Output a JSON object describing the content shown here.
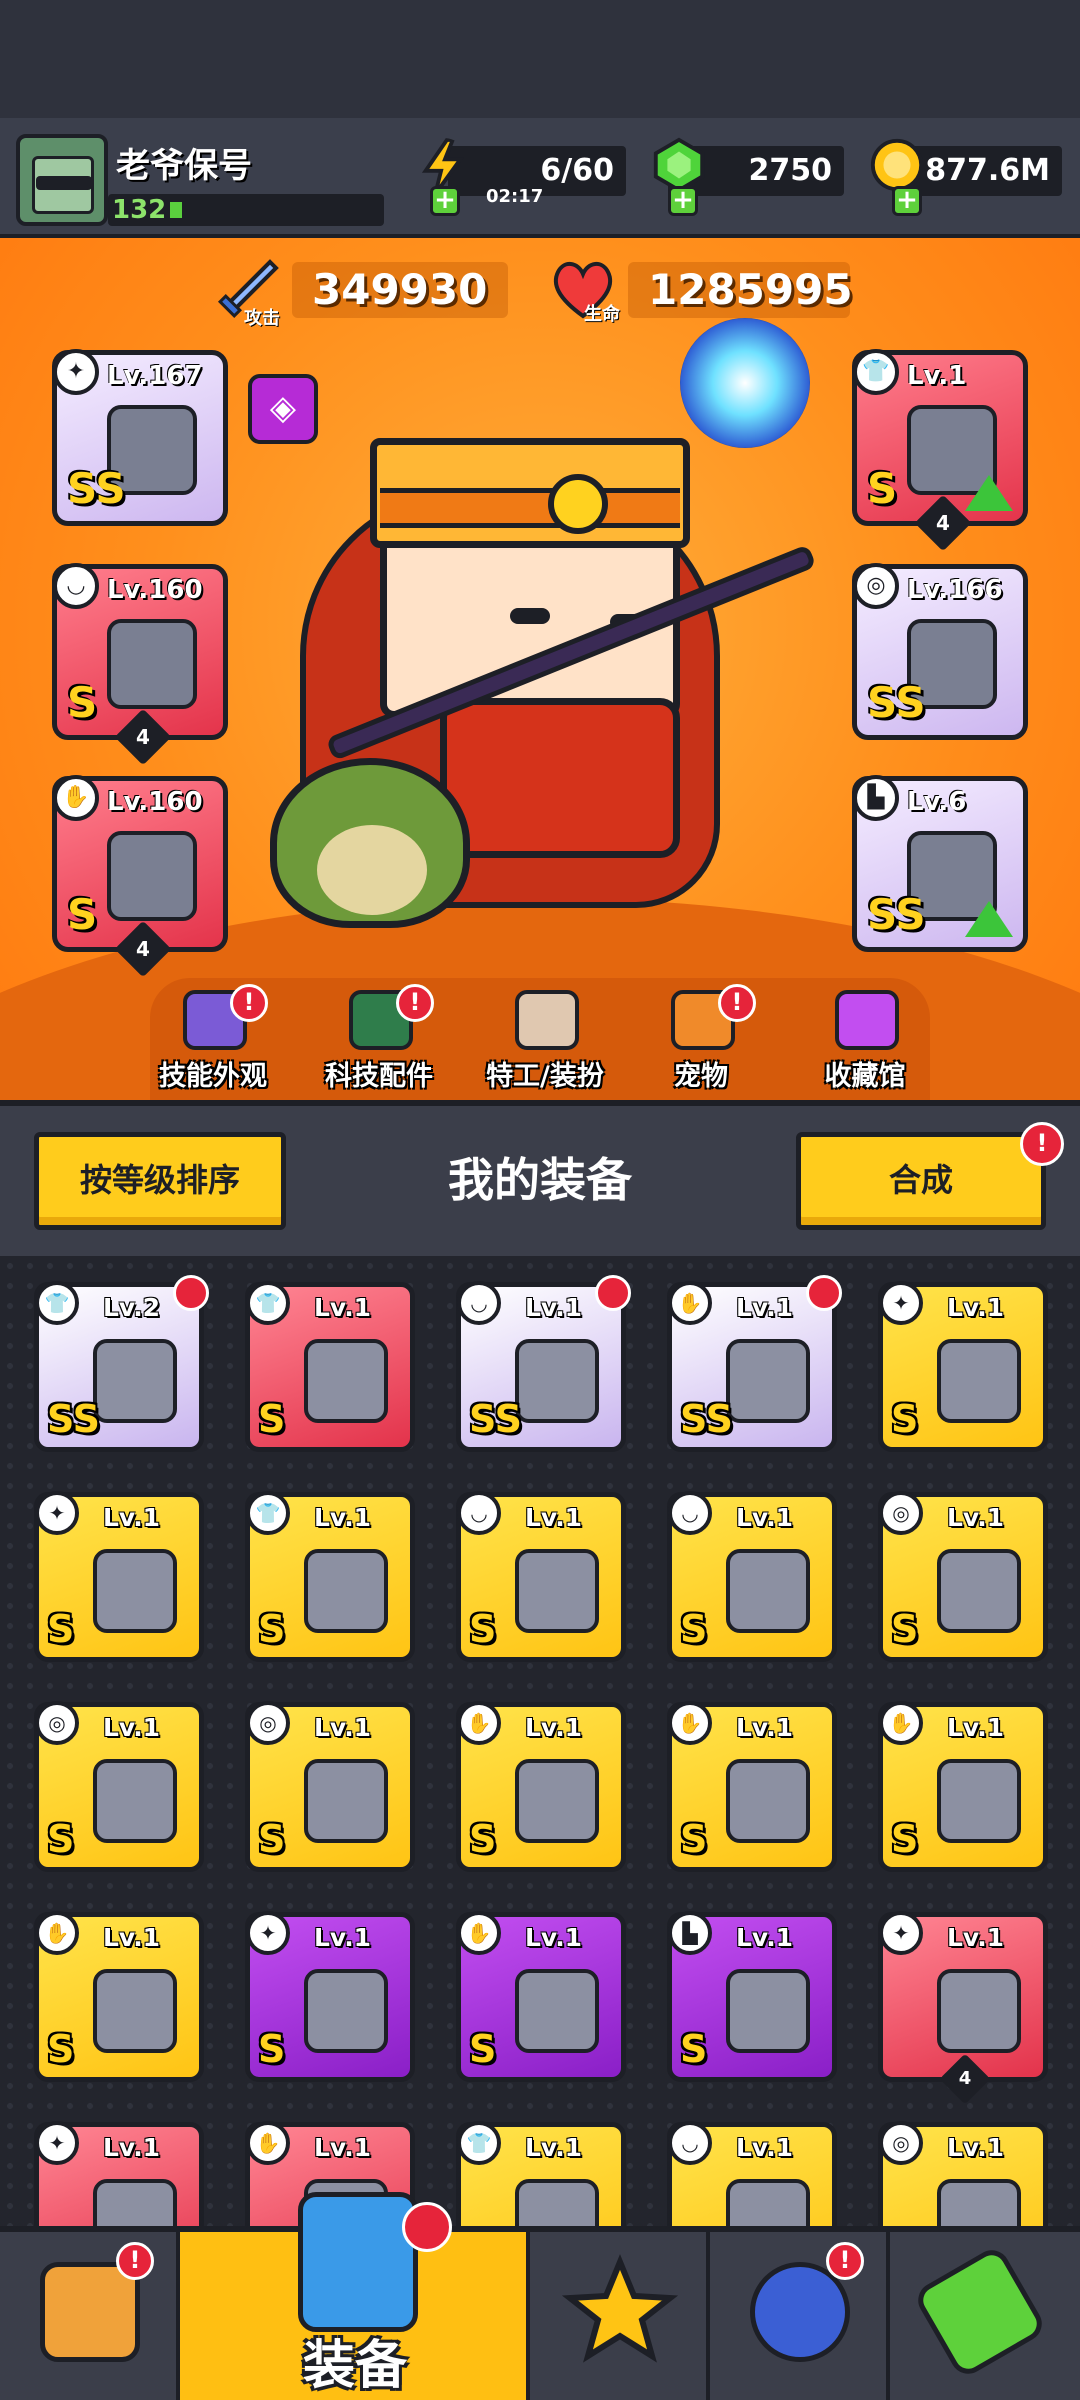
{
  "player": {
    "name": "老爷保号",
    "level": "132"
  },
  "resources": {
    "energy": "6/60",
    "energy_timer": "02:17",
    "gems": "2750",
    "gold": "877.6M"
  },
  "stats": {
    "attack_value": "349930",
    "attack_label": "攻击",
    "hp_value": "1285995",
    "hp_label": "生命"
  },
  "equipped": {
    "left": [
      {
        "level": "Lv.167",
        "grade": "SS",
        "color": "violet",
        "type_icon": "weapon-icon"
      },
      {
        "level": "Lv.160",
        "grade": "S",
        "color": "red",
        "type_icon": "necklace-icon",
        "stars": "4"
      },
      {
        "level": "Lv.160",
        "grade": "S",
        "color": "red",
        "type_icon": "glove-icon",
        "stars": "4"
      }
    ],
    "right": [
      {
        "level": "Lv.1",
        "grade": "S",
        "color": "red",
        "type_icon": "armor-icon",
        "stars": "4",
        "upgrade": true
      },
      {
        "level": "Lv.166",
        "grade": "SS",
        "color": "violet",
        "type_icon": "belt-icon"
      },
      {
        "level": "Lv.6",
        "grade": "SS",
        "color": "violet",
        "type_icon": "boots-icon",
        "upgrade": true
      }
    ]
  },
  "hero_menu": [
    {
      "label": "技能外观",
      "badge": "!"
    },
    {
      "label": "科技配件",
      "badge": "!"
    },
    {
      "label": "特工/装扮",
      "badge": ""
    },
    {
      "label": "宠物",
      "badge": "!"
    },
    {
      "label": "收藏馆",
      "badge": ""
    }
  ],
  "equipment_header": {
    "sort_label": "按等级排序",
    "title": "我的装备",
    "merge_label": "合成",
    "merge_badge": "!"
  },
  "inventory": [
    {
      "level": "Lv.2",
      "grade": "SS",
      "color": "violet",
      "icon": "armor-icon",
      "new": true
    },
    {
      "level": "Lv.1",
      "grade": "S",
      "color": "red",
      "icon": "armor-icon",
      "new": false
    },
    {
      "level": "Lv.1",
      "grade": "SS",
      "color": "violet",
      "icon": "necklace-icon",
      "new": true
    },
    {
      "level": "Lv.1",
      "grade": "SS",
      "color": "violet",
      "icon": "glove-icon",
      "new": true
    },
    {
      "level": "Lv.1",
      "grade": "S",
      "color": "yellow",
      "icon": "weapon-icon",
      "new": false
    },
    {
      "level": "Lv.1",
      "grade": "S",
      "color": "yellow",
      "icon": "weapon-icon",
      "new": false
    },
    {
      "level": "Lv.1",
      "grade": "S",
      "color": "yellow",
      "icon": "armor-icon",
      "new": false
    },
    {
      "level": "Lv.1",
      "grade": "S",
      "color": "yellow",
      "icon": "necklace-icon",
      "new": false
    },
    {
      "level": "Lv.1",
      "grade": "S",
      "color": "yellow",
      "icon": "necklace-icon",
      "new": false
    },
    {
      "level": "Lv.1",
      "grade": "S",
      "color": "yellow",
      "icon": "belt-icon",
      "new": false
    },
    {
      "level": "Lv.1",
      "grade": "S",
      "color": "yellow",
      "icon": "belt-icon",
      "new": false
    },
    {
      "level": "Lv.1",
      "grade": "S",
      "color": "yellow",
      "icon": "belt-icon",
      "new": false
    },
    {
      "level": "Lv.1",
      "grade": "S",
      "color": "yellow",
      "icon": "glove-icon",
      "new": false
    },
    {
      "level": "Lv.1",
      "grade": "S",
      "color": "yellow",
      "icon": "glove-icon",
      "new": false
    },
    {
      "level": "Lv.1",
      "grade": "S",
      "color": "yellow",
      "icon": "glove-icon",
      "new": false
    },
    {
      "level": "Lv.1",
      "grade": "S",
      "color": "yellow",
      "icon": "glove-icon",
      "new": false
    },
    {
      "level": "Lv.1",
      "grade": "S",
      "color": "purple",
      "icon": "weapon-icon",
      "new": false
    },
    {
      "level": "Lv.1",
      "grade": "S",
      "color": "purple",
      "icon": "glove-icon",
      "new": false
    },
    {
      "level": "Lv.1",
      "grade": "S",
      "color": "purple",
      "icon": "boots-icon",
      "new": false
    },
    {
      "level": "Lv.1",
      "grade": "",
      "color": "red",
      "icon": "weapon-icon",
      "new": false,
      "stars": "4"
    },
    {
      "level": "Lv.1",
      "grade": "",
      "color": "red",
      "icon": "weapon-icon",
      "new": false
    },
    {
      "level": "Lv.1",
      "grade": "",
      "color": "red",
      "icon": "glove-icon",
      "new": false
    },
    {
      "level": "Lv.1",
      "grade": "",
      "color": "yellow",
      "icon": "armor-icon",
      "new": false
    },
    {
      "level": "Lv.1",
      "grade": "",
      "color": "yellow",
      "icon": "necklace-icon",
      "new": false
    },
    {
      "level": "Lv.1",
      "grade": "",
      "color": "yellow",
      "icon": "belt-icon",
      "new": false
    }
  ],
  "nav": {
    "tabs": [
      {
        "name": "shop",
        "icon": "shop-icon",
        "badge": "!"
      },
      {
        "name": "equipment",
        "icon": "equipment-icon",
        "label": "装备",
        "active": true
      },
      {
        "name": "battle",
        "icon": "battle-icon"
      },
      {
        "name": "world",
        "icon": "planet-icon",
        "badge": "!"
      },
      {
        "name": "lab",
        "icon": "lab-icon"
      }
    ]
  },
  "colors": {
    "yellow": "#ffc414",
    "violet": "#c9b5ef",
    "red": "#e3334b",
    "purple": "#8a1fc7",
    "badge": "#e6243a"
  }
}
